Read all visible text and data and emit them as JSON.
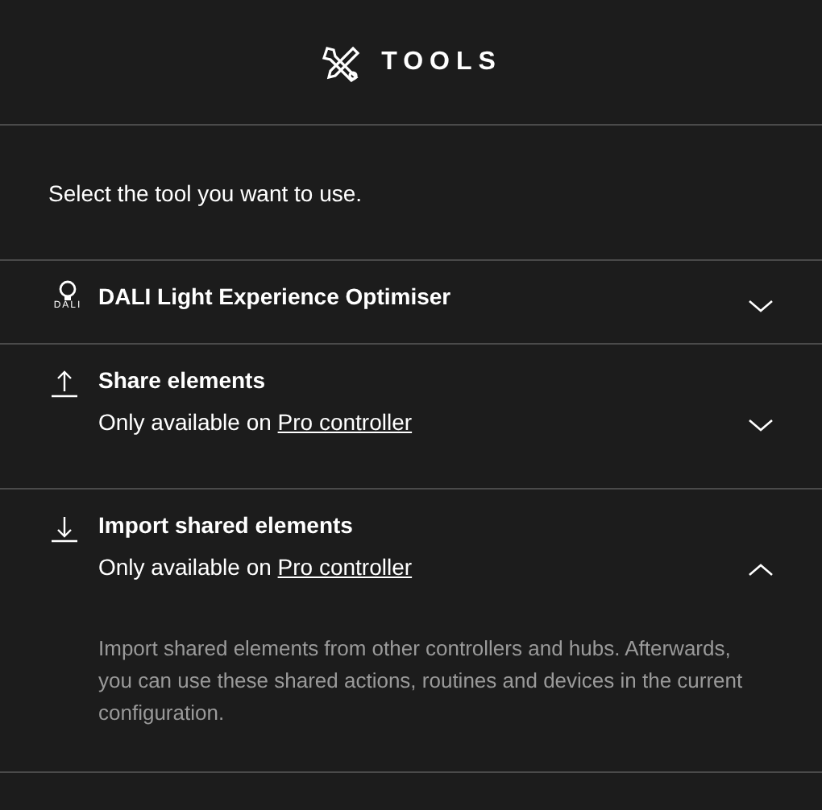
{
  "header": {
    "title": "TOOLS"
  },
  "intro": "Select the tool you want to use.",
  "tools": [
    {
      "kind": "dali",
      "logo_text": "DALI",
      "title": "DALI Light Experience Optimiser",
      "expanded": false
    },
    {
      "kind": "share",
      "title": "Share elements",
      "note": "Only available on ",
      "link": "Pro controller",
      "expanded": false
    },
    {
      "kind": "import",
      "title": "Import shared elements",
      "note": "Only available on ",
      "link": "Pro controller",
      "expanded": true,
      "description": "Import shared elements from other controllers and hubs. Afterwards, you can use these shared actions, routines and devices in the current configuration."
    }
  ]
}
